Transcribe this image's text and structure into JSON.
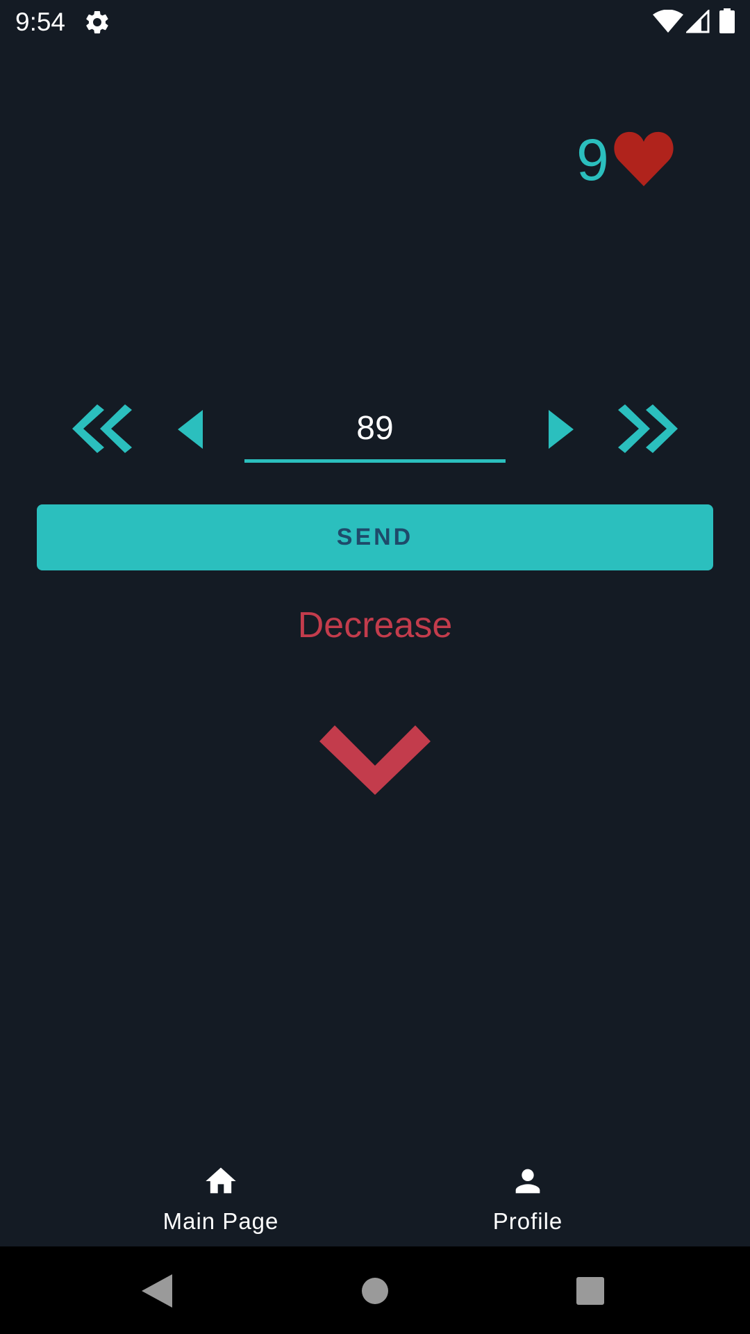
{
  "status_bar": {
    "time": "9:54",
    "icons": [
      "gear-icon",
      "wifi-icon",
      "signal-icon",
      "battery-icon"
    ]
  },
  "lives": {
    "count": "9",
    "icon": "heart-icon",
    "icon_color": "#b0231c",
    "count_color": "#2bbfbe"
  },
  "stepper": {
    "value": "89",
    "controls": [
      "double-chevron-left-icon",
      "triangle-left-icon",
      "triangle-right-icon",
      "double-chevron-right-icon"
    ]
  },
  "send_button": {
    "label": "SEND"
  },
  "feedback": {
    "text": "Decrease",
    "color": "#c33c4c",
    "icon": "chevron-down-icon"
  },
  "bottom_nav": {
    "items": [
      {
        "label": "Main Page",
        "icon": "home-icon"
      },
      {
        "label": "Profile",
        "icon": "person-icon"
      }
    ]
  },
  "system_nav": {
    "buttons": [
      "back-icon",
      "home-circle-icon",
      "recents-icon"
    ]
  },
  "colors": {
    "background": "#141b24",
    "accent": "#2bbfbe",
    "button_text": "#1e4a6a"
  }
}
